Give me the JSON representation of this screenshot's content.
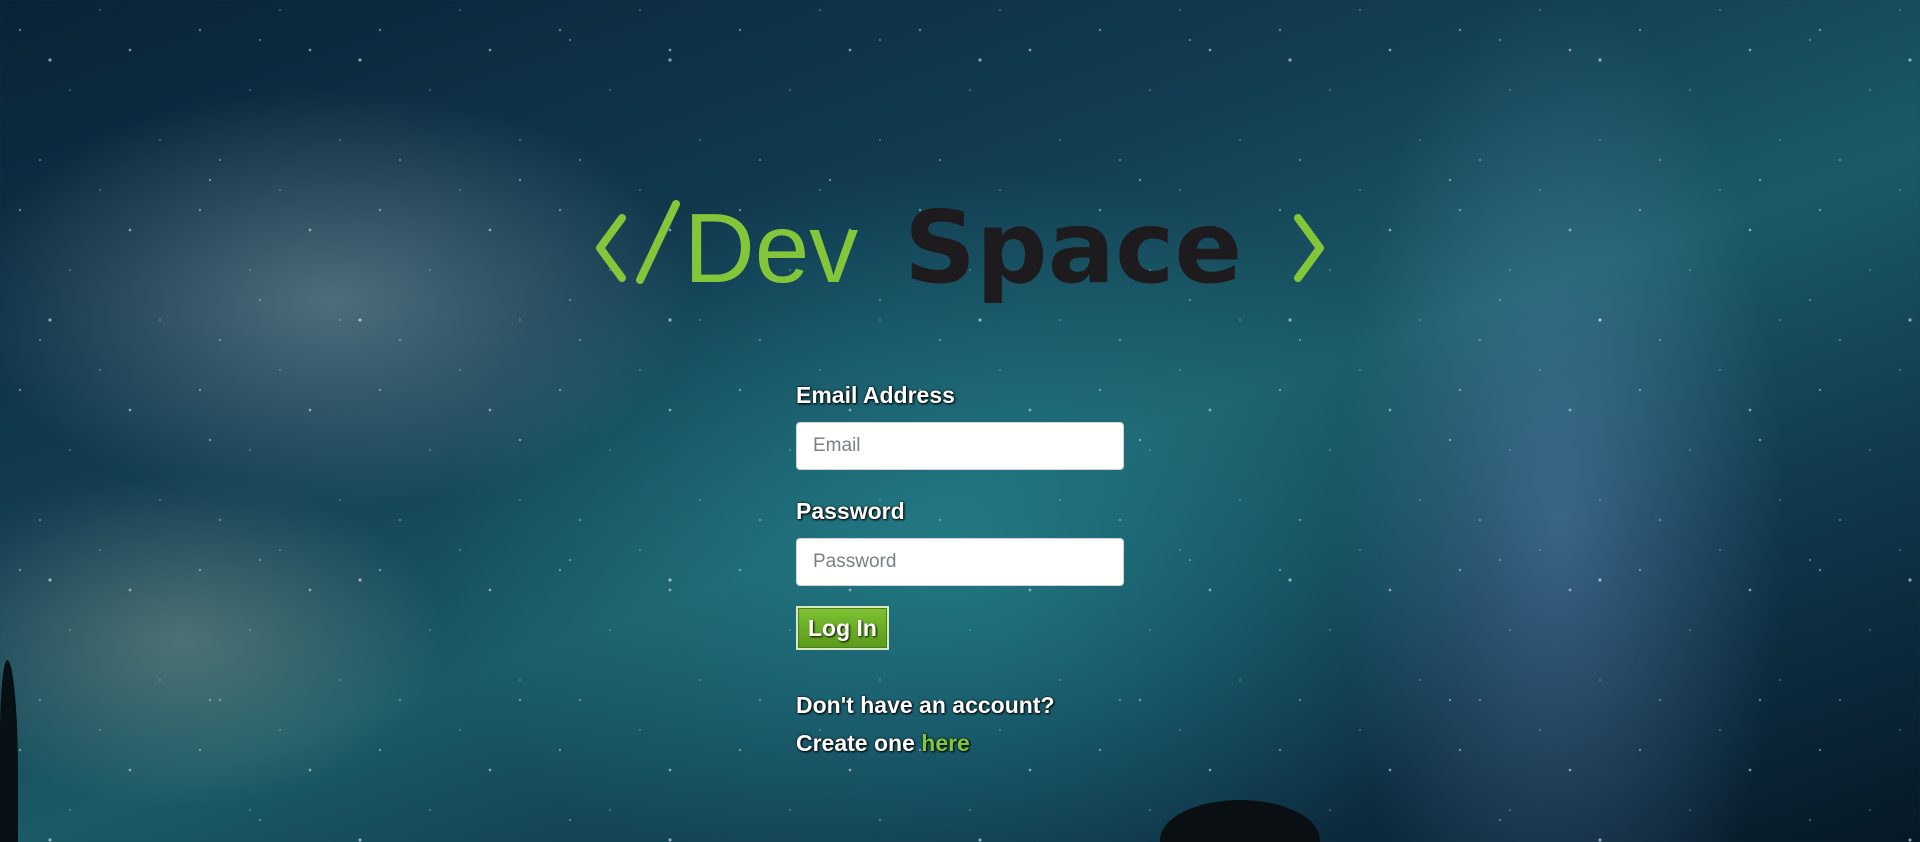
{
  "logo": {
    "open_bracket": "</",
    "dev": "Dev",
    "space": "Space",
    "close_bracket": ">",
    "accent_color": "#84c63a",
    "dark_color": "#1e1b1e"
  },
  "form": {
    "email_label": "Email Address",
    "email_placeholder": "Email",
    "password_label": "Password",
    "password_placeholder": "Password",
    "login_button": "Log In"
  },
  "signup": {
    "question": "Don't have an account?",
    "prompt": "Create one",
    "link_text": "here"
  },
  "colors": {
    "button_green": "#6fb02a",
    "link_green": "#84c63a"
  }
}
